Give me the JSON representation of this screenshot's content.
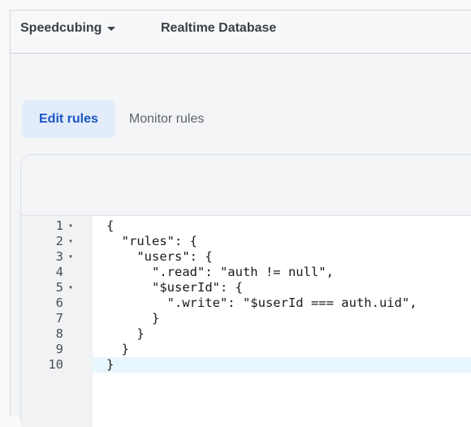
{
  "header": {
    "project_name": "Speedcubing",
    "section_title": "Realtime Database"
  },
  "tabs": [
    {
      "label": "Edit rules",
      "active": true
    },
    {
      "label": "Monitor rules",
      "active": false
    }
  ],
  "editor": {
    "current_line": 10,
    "lines": [
      {
        "num": "1",
        "fold": true,
        "text": "{"
      },
      {
        "num": "2",
        "fold": true,
        "text": "  \"rules\": {"
      },
      {
        "num": "3",
        "fold": true,
        "text": "    \"users\": {"
      },
      {
        "num": "4",
        "fold": false,
        "text": "      \".read\": \"auth != null\","
      },
      {
        "num": "5",
        "fold": true,
        "text": "      \"$userId\": {"
      },
      {
        "num": "6",
        "fold": false,
        "text": "        \".write\": \"$userId === auth.uid\","
      },
      {
        "num": "7",
        "fold": false,
        "text": "      }"
      },
      {
        "num": "8",
        "fold": false,
        "text": "    }"
      },
      {
        "num": "9",
        "fold": false,
        "text": "  }"
      },
      {
        "num": "10",
        "fold": false,
        "text": "}"
      }
    ]
  },
  "colors": {
    "accent": "#1a56c2",
    "active_tab_bg": "#e3ecfb",
    "current_line_bg": "#e8f6fd"
  }
}
